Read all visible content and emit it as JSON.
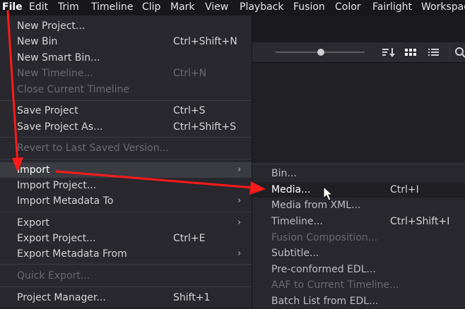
{
  "menubar": {
    "items": [
      {
        "label": "File"
      },
      {
        "label": "Edit"
      },
      {
        "label": "Trim"
      },
      {
        "label": "Timeline"
      },
      {
        "label": "Clip"
      },
      {
        "label": "Mark"
      },
      {
        "label": "View"
      },
      {
        "label": "Playback"
      },
      {
        "label": "Fusion"
      },
      {
        "label": "Color"
      },
      {
        "label": "Fairlight"
      },
      {
        "label": "Workspace"
      }
    ]
  },
  "toolbar": {
    "icons": [
      "sort-icon",
      "grid-view-icon",
      "list-view-icon",
      "search-icon"
    ]
  },
  "file_menu": {
    "items": [
      {
        "label": "New Project...",
        "shortcut": ""
      },
      {
        "label": "New Bin",
        "shortcut": "Ctrl+Shift+N"
      },
      {
        "label": "New Smart Bin...",
        "shortcut": ""
      },
      {
        "label": "New Timeline...",
        "shortcut": "Ctrl+N",
        "disabled": true
      },
      {
        "label": "Close Current Timeline",
        "shortcut": "",
        "disabled": true
      },
      {
        "label": "Save Project",
        "shortcut": "Ctrl+S"
      },
      {
        "label": "Save Project As...",
        "shortcut": "Ctrl+Shift+S"
      },
      {
        "label": "Revert to Last Saved Version...",
        "shortcut": "",
        "disabled": true
      },
      {
        "label": "Import",
        "shortcut": "",
        "submenu": true
      },
      {
        "label": "Import Project...",
        "shortcut": ""
      },
      {
        "label": "Import Metadata To",
        "shortcut": "",
        "submenu": true
      },
      {
        "label": "Export",
        "shortcut": "",
        "submenu": true
      },
      {
        "label": "Export Project...",
        "shortcut": "Ctrl+E"
      },
      {
        "label": "Export Metadata From",
        "shortcut": "",
        "submenu": true
      },
      {
        "label": "Quick Export...",
        "shortcut": "",
        "disabled": true
      },
      {
        "label": "Project Manager...",
        "shortcut": "Shift+1"
      }
    ]
  },
  "import_submenu": {
    "items": [
      {
        "label": "Bin...",
        "shortcut": ""
      },
      {
        "label": "Media...",
        "shortcut": "Ctrl+I"
      },
      {
        "label": "Media from XML...",
        "shortcut": ""
      },
      {
        "label": "Timeline...",
        "shortcut": "Ctrl+Shift+I"
      },
      {
        "label": "Fusion Composition...",
        "shortcut": "",
        "disabled": true
      },
      {
        "label": "Subtitle...",
        "shortcut": ""
      },
      {
        "label": "Pre-conformed EDL...",
        "shortcut": ""
      },
      {
        "label": "AAF to Current Timeline...",
        "shortcut": "",
        "disabled": true
      },
      {
        "label": "Batch List from EDL...",
        "shortcut": ""
      }
    ]
  },
  "colors": {
    "annotation_arrow": "#ff1a1a",
    "menu_bg": "#28282e",
    "highlight_bg": "#3b3b42"
  }
}
